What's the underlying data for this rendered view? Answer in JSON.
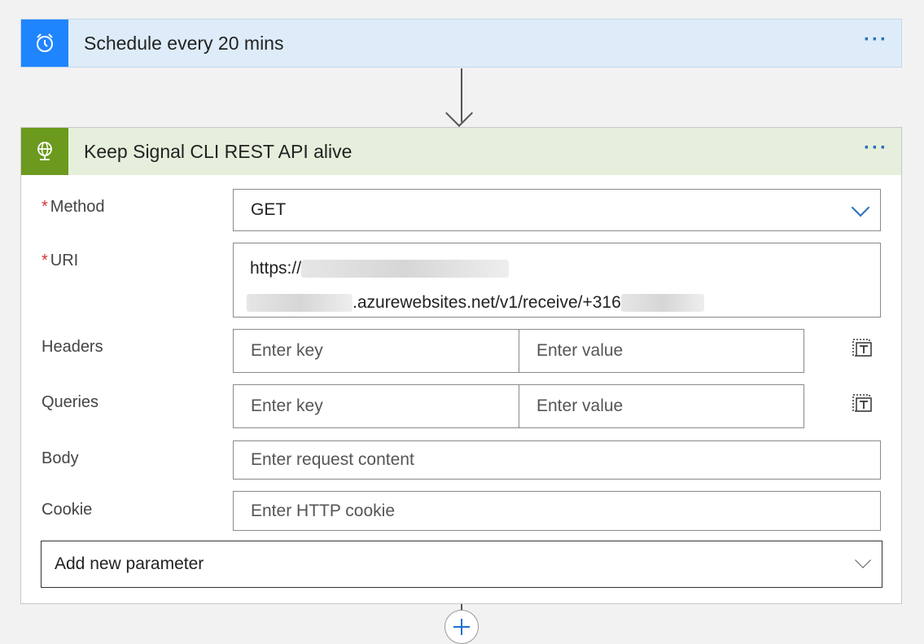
{
  "trigger": {
    "title": "Schedule every 20 mins",
    "icon": "alarm-clock-icon",
    "more_label": "···"
  },
  "action": {
    "title": "Keep Signal CLI REST API alive",
    "icon": "globe-icon",
    "more_label": "···",
    "method": {
      "label": "Method",
      "value": "GET"
    },
    "uri": {
      "label": "URI",
      "prefix": "https://",
      "middle": ".azurewebsites.net/v1/receive/+316"
    },
    "headers": {
      "label": "Headers",
      "key_placeholder": "Enter key",
      "value_placeholder": "Enter value"
    },
    "queries": {
      "label": "Queries",
      "key_placeholder": "Enter key",
      "value_placeholder": "Enter value"
    },
    "body": {
      "label": "Body",
      "placeholder": "Enter request content"
    },
    "cookie": {
      "label": "Cookie",
      "placeholder": "Enter HTTP cookie"
    },
    "add_parameter": {
      "label": "Add new parameter"
    },
    "required_mark": "*"
  },
  "colors": {
    "trigger_accent": "#1f85ff",
    "action_accent": "#6b9a1e",
    "link": "#2a6fbd"
  }
}
